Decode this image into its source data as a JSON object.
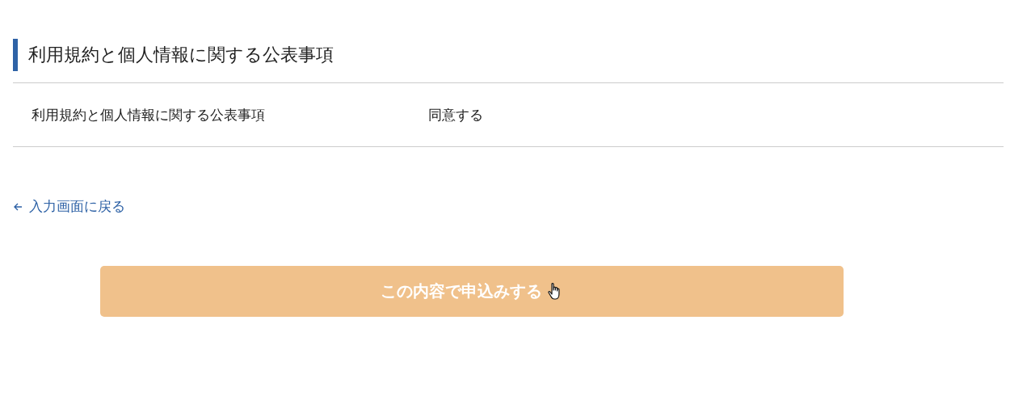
{
  "section": {
    "title": "利用規約と個人情報に関する公表事項"
  },
  "rows": [
    {
      "label": "利用規約と個人情報に関する公表事項",
      "value": "同意する"
    }
  ],
  "back_link": {
    "label": "入力画面に戻る"
  },
  "submit_button": {
    "label": "この内容で申込みする"
  }
}
